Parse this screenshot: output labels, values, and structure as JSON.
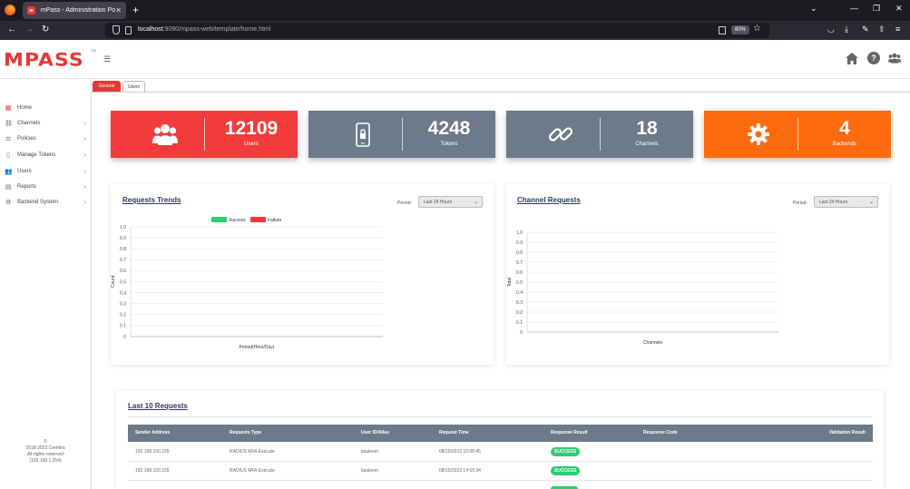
{
  "browser": {
    "tab_title": "mPass - Administration Portal",
    "url_host": "localhost:",
    "url_path": "9090/mpass-web/template/home.html",
    "zoom": "80%"
  },
  "app": {
    "logo": "MPASS",
    "logo_tm": "TM"
  },
  "sidebar": {
    "items": [
      {
        "label": "Home",
        "icon": "grid-icon",
        "has_children": false
      },
      {
        "label": "Channels",
        "icon": "link-icon",
        "has_children": true
      },
      {
        "label": "Policies",
        "icon": "gavel-icon",
        "has_children": true
      },
      {
        "label": "Manage Tokens",
        "icon": "phone-icon",
        "has_children": true
      },
      {
        "label": "Users",
        "icon": "users-icon",
        "has_children": true
      },
      {
        "label": "Reports",
        "icon": "document-icon",
        "has_children": true
      },
      {
        "label": "Backend System",
        "icon": "gear-icon",
        "has_children": true
      }
    ],
    "footer": {
      "copyright_symbol": "©",
      "line1": "2018-2023 Cerebra",
      "line2": "All rights reserved",
      "line3": "(192.168.1.254)"
    }
  },
  "content_tabs": [
    {
      "label": "General",
      "active": true
    },
    {
      "label": "Users",
      "active": false
    }
  ],
  "cards": [
    {
      "value": "12109",
      "label": "Users",
      "color": "#f23c3c",
      "icon": "users-icon"
    },
    {
      "value": "4248",
      "label": "Tokens",
      "color": "#6c7a89",
      "icon": "phone-lock-icon"
    },
    {
      "value": "18",
      "label": "Channels",
      "color": "#6c7a89",
      "icon": "link-icon"
    },
    {
      "value": "4",
      "label": "Backends",
      "color": "#fe6a0e",
      "icon": "gear-icon"
    }
  ],
  "requests_trends": {
    "title": "Requests Trends",
    "period_label": "Period:",
    "period_value": "Last 24 Hours"
  },
  "channel_requests": {
    "title": "Channel Requests",
    "period_label": "Period:",
    "period_value": "Last 24 Hours"
  },
  "chart_data": [
    {
      "type": "line",
      "title": "",
      "xlabel": "Period(Hour/Day)",
      "ylabel": "Count",
      "ylim": [
        0,
        1
      ],
      "yticks": [
        "1.0",
        "0.9",
        "0.8",
        "0.7",
        "0.6",
        "0.5",
        "0.4",
        "0.3",
        "0.2",
        "0.1",
        "0"
      ],
      "series": [
        {
          "name": "Success",
          "color": "#2ecc71",
          "values": []
        },
        {
          "name": "Failure",
          "color": "#f23c3c",
          "values": []
        }
      ],
      "legend": "top-center",
      "grid": true
    },
    {
      "type": "bar",
      "title": "",
      "xlabel": "Channels",
      "ylabel": "Total",
      "ylim": [
        0,
        1
      ],
      "yticks": [
        "1.0",
        "0.9",
        "0.8",
        "0.7",
        "0.6",
        "0.5",
        "0.4",
        "0.3",
        "0.2",
        "0.1",
        "0"
      ],
      "categories": [],
      "values": [],
      "grid": true
    }
  ],
  "last_requests": {
    "title": "Last 10 Requests",
    "columns": [
      "Sender Address",
      "Requests Type",
      "User ID/Alias",
      "Request Time",
      "Response Result",
      "Response Code",
      "Validation Result"
    ],
    "rows": [
      {
        "sender": "192.168.100.155",
        "type": "RADIUS MFA Execute",
        "user": "bsaleem",
        "time": "08/15/2023 15:08:45",
        "result": "SUCCESS",
        "code": "",
        "validation": ""
      },
      {
        "sender": "192.168.100.155",
        "type": "RADIUS MFA Execute",
        "user": "bsaleem",
        "time": "08/15/2023 14:59:34",
        "result": "SUCCESS",
        "code": "",
        "validation": ""
      }
    ]
  }
}
